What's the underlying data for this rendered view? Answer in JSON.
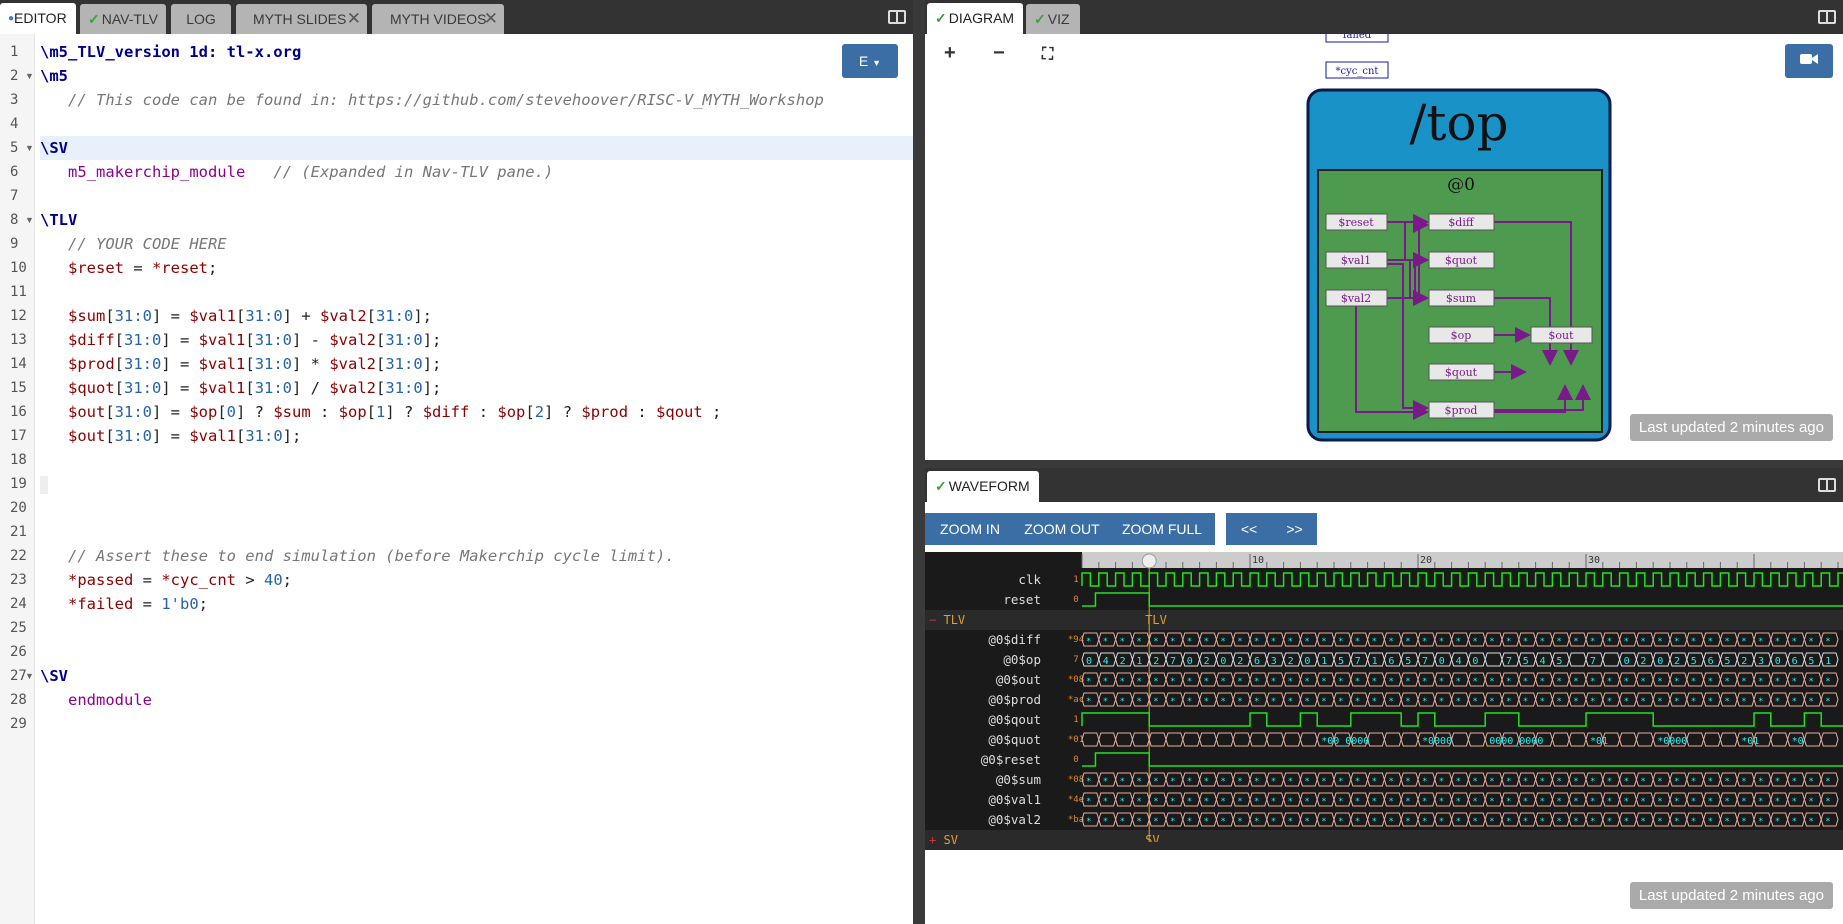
{
  "editor": {
    "tabs": [
      "EDITOR",
      "NAV-TLV",
      "LOG",
      "MYTH SLIDES",
      "MYTH VIDEOS"
    ],
    "e_button": "E",
    "lines": [
      {
        "n": "1",
        "parts": [
          [
            "kw",
            "\\m5_TLV_version 1d: tl-x.org"
          ]
        ]
      },
      {
        "n": "2",
        "fold": true,
        "parts": [
          [
            "kw",
            "\\m5"
          ]
        ]
      },
      {
        "n": "3",
        "parts": [
          [
            "",
            "   "
          ],
          [
            "cm",
            "// This code can be found in: https://github.com/stevehoover/RISC-V_MYTH_Workshop"
          ]
        ]
      },
      {
        "n": "4",
        "parts": []
      },
      {
        "n": "5",
        "fold": true,
        "hl": true,
        "parts": [
          [
            "kw",
            "\\SV"
          ]
        ]
      },
      {
        "n": "6",
        "parts": [
          [
            "",
            "   "
          ],
          [
            "mk",
            "m5_makerchip_module"
          ],
          [
            "",
            "   "
          ],
          [
            "cm",
            "// (Expanded in Nav-TLV pane.)"
          ]
        ]
      },
      {
        "n": "7",
        "parts": []
      },
      {
        "n": "8",
        "fold": true,
        "parts": [
          [
            "kw",
            "\\TLV"
          ]
        ]
      },
      {
        "n": "9",
        "parts": [
          [
            "",
            "   "
          ],
          [
            "cm",
            "// YOUR CODE HERE"
          ]
        ]
      },
      {
        "n": "10",
        "parts": [
          [
            "",
            "   "
          ],
          [
            "sg",
            "$reset"
          ],
          [
            "",
            " = "
          ],
          [
            "pp",
            "*reset"
          ],
          [
            "",
            ";"
          ]
        ]
      },
      {
        "n": "11",
        "parts": []
      },
      {
        "n": "12",
        "parts": [
          [
            "",
            "   "
          ],
          [
            "sg",
            "$sum"
          ],
          [
            "",
            "["
          ],
          [
            "nm",
            "31:0"
          ],
          [
            "",
            "] = "
          ],
          [
            "sg",
            "$val1"
          ],
          [
            "",
            "["
          ],
          [
            "nm",
            "31:0"
          ],
          [
            "",
            "] + "
          ],
          [
            "sg",
            "$val2"
          ],
          [
            "",
            "["
          ],
          [
            "nm",
            "31:0"
          ],
          [
            "",
            "];"
          ]
        ]
      },
      {
        "n": "13",
        "parts": [
          [
            "",
            "   "
          ],
          [
            "sg",
            "$diff"
          ],
          [
            "",
            "["
          ],
          [
            "nm",
            "31:0"
          ],
          [
            "",
            "] = "
          ],
          [
            "sg",
            "$val1"
          ],
          [
            "",
            "["
          ],
          [
            "nm",
            "31:0"
          ],
          [
            "",
            "] - "
          ],
          [
            "sg",
            "$val2"
          ],
          [
            "",
            "["
          ],
          [
            "nm",
            "31:0"
          ],
          [
            "",
            "];"
          ]
        ]
      },
      {
        "n": "14",
        "parts": [
          [
            "",
            "   "
          ],
          [
            "sg",
            "$prod"
          ],
          [
            "",
            "["
          ],
          [
            "nm",
            "31:0"
          ],
          [
            "",
            "] = "
          ],
          [
            "sg",
            "$val1"
          ],
          [
            "",
            "["
          ],
          [
            "nm",
            "31:0"
          ],
          [
            "",
            "] * "
          ],
          [
            "sg",
            "$val2"
          ],
          [
            "",
            "["
          ],
          [
            "nm",
            "31:0"
          ],
          [
            "",
            "];"
          ]
        ]
      },
      {
        "n": "15",
        "parts": [
          [
            "",
            "   "
          ],
          [
            "sg",
            "$quot"
          ],
          [
            "",
            "["
          ],
          [
            "nm",
            "31:0"
          ],
          [
            "",
            "] = "
          ],
          [
            "sg",
            "$val1"
          ],
          [
            "",
            "["
          ],
          [
            "nm",
            "31:0"
          ],
          [
            "",
            "] / "
          ],
          [
            "sg",
            "$val2"
          ],
          [
            "",
            "["
          ],
          [
            "nm",
            "31:0"
          ],
          [
            "",
            "];"
          ]
        ]
      },
      {
        "n": "16",
        "parts": [
          [
            "",
            "   "
          ],
          [
            "sg",
            "$out"
          ],
          [
            "",
            "["
          ],
          [
            "nm",
            "31:0"
          ],
          [
            "",
            "] = "
          ],
          [
            "sg",
            "$op"
          ],
          [
            "",
            "["
          ],
          [
            "nm",
            "0"
          ],
          [
            "",
            "] ? "
          ],
          [
            "sg",
            "$sum"
          ],
          [
            "",
            " : "
          ],
          [
            "sg",
            "$op"
          ],
          [
            "",
            "["
          ],
          [
            "nm",
            "1"
          ],
          [
            "",
            "] ? "
          ],
          [
            "sg",
            "$diff"
          ],
          [
            "",
            " : "
          ],
          [
            "sg",
            "$op"
          ],
          [
            "",
            "["
          ],
          [
            "nm",
            "2"
          ],
          [
            "",
            "] ? "
          ],
          [
            "sg",
            "$prod"
          ],
          [
            "",
            " : "
          ],
          [
            "sg",
            "$qout"
          ],
          [
            "",
            " ;"
          ]
        ]
      },
      {
        "n": "17",
        "parts": [
          [
            "",
            "   "
          ],
          [
            "sg",
            "$out"
          ],
          [
            "",
            "["
          ],
          [
            "nm",
            "31:0"
          ],
          [
            "",
            "] = "
          ],
          [
            "sg",
            "$val1"
          ],
          [
            "",
            "["
          ],
          [
            "nm",
            "31:0"
          ],
          [
            "",
            "];"
          ]
        ]
      },
      {
        "n": "18",
        "parts": []
      },
      {
        "n": "19",
        "parts": []
      },
      {
        "n": "20",
        "parts": []
      },
      {
        "n": "21",
        "parts": []
      },
      {
        "n": "22",
        "parts": [
          [
            "",
            "   "
          ],
          [
            "cm",
            "// Assert these to end simulation (before Makerchip cycle limit)."
          ]
        ]
      },
      {
        "n": "23",
        "parts": [
          [
            "",
            "   "
          ],
          [
            "pp",
            "*passed"
          ],
          [
            "",
            " = "
          ],
          [
            "pp",
            "*cyc_cnt"
          ],
          [
            "",
            " > "
          ],
          [
            "nm",
            "40"
          ],
          [
            "",
            ";"
          ]
        ]
      },
      {
        "n": "24",
        "parts": [
          [
            "",
            "   "
          ],
          [
            "pp",
            "*failed"
          ],
          [
            "",
            " = "
          ],
          [
            "nm",
            "1'b0"
          ],
          [
            "",
            ";"
          ]
        ]
      },
      {
        "n": "25",
        "parts": []
      },
      {
        "n": "26",
        "parts": []
      },
      {
        "n": "27",
        "fold": true,
        "parts": [
          [
            "kw",
            "\\SV"
          ]
        ]
      },
      {
        "n": "28",
        "parts": [
          [
            "",
            "   "
          ],
          [
            "mk",
            "endmodule"
          ]
        ]
      },
      {
        "n": "29",
        "parts": []
      }
    ]
  },
  "diagram": {
    "tabs": [
      "DIAGRAM",
      "VIZ"
    ],
    "zoom_in": "+",
    "zoom_out": "−",
    "fit": "⛶",
    "top_label": "/top",
    "stage_label": "@0",
    "partial_top_label": "failed",
    "cyc_label": "*cyc_cnt",
    "nodes": [
      "$reset",
      "$diff",
      "$val1",
      "$quot",
      "$val2",
      "$sum",
      "$op",
      "$out",
      "$qout",
      "$prod"
    ],
    "updated": "Last updated 2 minutes ago"
  },
  "waveform": {
    "tab": "WAVEFORM",
    "buttons": [
      "ZOOM IN",
      "ZOOM OUT",
      "ZOOM FULL",
      "<<",
      ">>"
    ],
    "ruler": [
      "10",
      "20",
      "30"
    ],
    "group_tlv": "TLV",
    "group_sv": "SV",
    "signals": [
      {
        "name": "clk",
        "val": "1"
      },
      {
        "name": "reset",
        "val": "0"
      },
      {
        "name": "@0$diff",
        "val": "*94"
      },
      {
        "name": "@0$op",
        "val": "7"
      },
      {
        "name": "@0$out",
        "val": "*08"
      },
      {
        "name": "@0$prod",
        "val": "*ac"
      },
      {
        "name": "@0$qout",
        "val": "1"
      },
      {
        "name": "@0$quot",
        "val": "*01"
      },
      {
        "name": "@0$reset",
        "val": "0"
      },
      {
        "name": "@0$sum",
        "val": "*08"
      },
      {
        "name": "@0$val1",
        "val": "*4e"
      },
      {
        "name": "@0$val2",
        "val": "*ba"
      }
    ],
    "op_values": [
      "0",
      "4",
      "2",
      "1",
      "2",
      "7",
      "0",
      "2",
      "0",
      "2",
      "6",
      "3",
      "2",
      "0",
      "1",
      "5",
      "7",
      "1",
      "6",
      "5",
      "7",
      "0",
      "4",
      "0",
      "",
      "7",
      "5",
      "4",
      "5",
      "",
      "7",
      "",
      "0",
      "2",
      "0",
      "2",
      "5",
      "6",
      "5",
      "2",
      "3",
      "0",
      "6",
      "5",
      "1"
    ],
    "quot_labels": [
      "*00_0000",
      "*0000",
      "0000_0000",
      "*01",
      "*0000",
      "*01",
      "*0"
    ],
    "updated": "Last updated 2 minutes ago"
  }
}
